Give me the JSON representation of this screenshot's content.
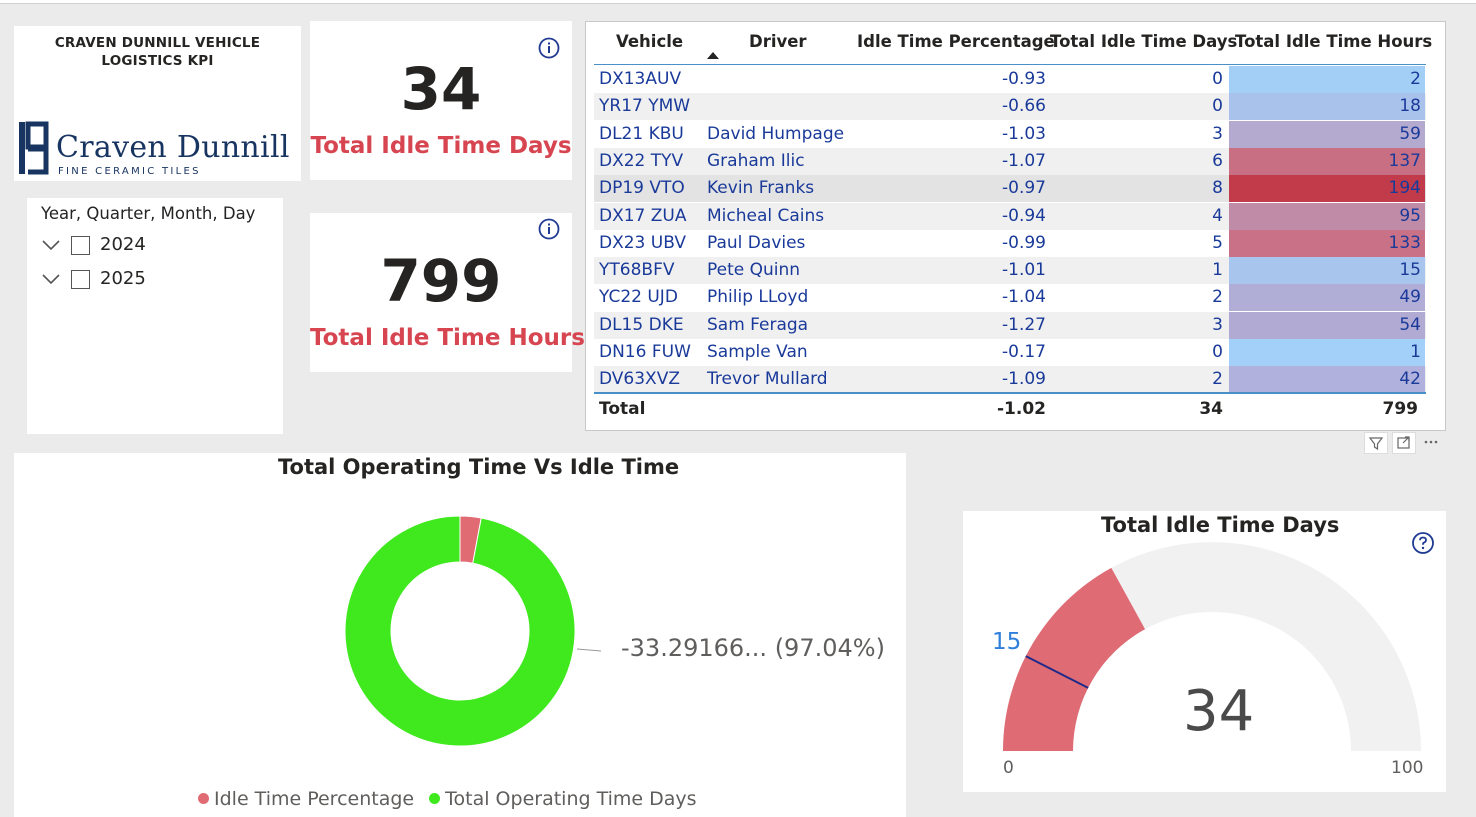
{
  "header": {
    "title": "CRAVEN DUNNILL VEHICLE LOGISTICS KPI",
    "logo_name": "Craven Dunnill",
    "logo_tagline": "FINE CERAMIC TILES"
  },
  "kpis": [
    {
      "value": "34",
      "label": "Total Idle Time Days"
    },
    {
      "value": "799",
      "label": "Total Idle Time Hours"
    }
  ],
  "slicer": {
    "title": "Year, Quarter, Month, Day",
    "items": [
      {
        "label": "2024",
        "checked": false
      },
      {
        "label": "2025",
        "checked": false
      }
    ]
  },
  "table": {
    "headers": [
      "Vehicle",
      "Driver",
      "Idle Time Percentage",
      "Total Idle Time Days",
      "Total Idle Time Hours"
    ],
    "sorted_column": "Driver",
    "rows": [
      {
        "vehicle": "DX13AUV",
        "driver": "",
        "pct": "-0.93",
        "days": "0",
        "hours": "2",
        "color": "#a3cff7"
      },
      {
        "vehicle": "YR17 YMW",
        "driver": "",
        "pct": "-0.66",
        "days": "0",
        "hours": "18",
        "color": "#a9c2ec"
      },
      {
        "vehicle": "DL21 KBU",
        "driver": "David Humpage",
        "pct": "-1.03",
        "days": "3",
        "hours": "59",
        "color": "#b4a9cf"
      },
      {
        "vehicle": "DX22 TYV",
        "driver": "Graham Ilic",
        "pct": "-1.07",
        "days": "6",
        "hours": "137",
        "color": "#c86f84"
      },
      {
        "vehicle": "DP19 VTO",
        "driver": "Kevin Franks",
        "pct": "-0.97",
        "days": "8",
        "hours": "194",
        "color": "#c23b4b"
      },
      {
        "vehicle": "DX17 ZUA",
        "driver": "Micheal Cains",
        "pct": "-0.94",
        "days": "4",
        "hours": "95",
        "color": "#bf8ba6"
      },
      {
        "vehicle": "DX23 UBV",
        "driver": "Paul Davies",
        "pct": "-0.99",
        "days": "5",
        "hours": "133",
        "color": "#c87187"
      },
      {
        "vehicle": "YT68BFV",
        "driver": "Pete Quinn",
        "pct": "-1.01",
        "days": "1",
        "hours": "15",
        "color": "#a8c5ee"
      },
      {
        "vehicle": "YC22 UJD",
        "driver": "Philip LLoyd",
        "pct": "-1.04",
        "days": "2",
        "hours": "49",
        "color": "#b0add7"
      },
      {
        "vehicle": "DL15 DKE",
        "driver": "Sam Feraga",
        "pct": "-1.27",
        "days": "3",
        "hours": "54",
        "color": "#b1abd4"
      },
      {
        "vehicle": "DN16 FUW",
        "driver": "Sample Van",
        "pct": "-0.17",
        "days": "0",
        "hours": "1",
        "color": "#a3d0f8"
      },
      {
        "vehicle": "DV63XVZ",
        "driver": "Trevor Mullard",
        "pct": "-1.09",
        "days": "2",
        "hours": "42",
        "color": "#b0b1dc"
      }
    ],
    "total": {
      "label": "Total",
      "pct": "-1.02",
      "days": "34",
      "hours": "799"
    }
  },
  "donut": {
    "title": "Total Operating Time Vs Idle Time",
    "data_label": "-33.29166... (97.04%)",
    "legend": [
      {
        "label": "Idle Time Percentage",
        "color": "#e06b73"
      },
      {
        "label": "Total Operating Time Days",
        "color": "#3fe91e"
      }
    ]
  },
  "gauge": {
    "title": "Total Idle Time Days",
    "value": "34",
    "target": "15",
    "min": "0",
    "max": "100",
    "fill_color": "#df6b74",
    "track_color": "#f1f1f1"
  },
  "chart_data": [
    {
      "type": "pie",
      "title": "Total Operating Time Vs Idle Time",
      "series": [
        {
          "name": "Idle Time Percentage",
          "value": 2.96
        },
        {
          "name": "Total Operating Time Days",
          "value": 97.04
        }
      ]
    },
    {
      "type": "gauge",
      "title": "Total Idle Time Days",
      "value": 34,
      "target": 15,
      "min": 0,
      "max": 100
    }
  ]
}
